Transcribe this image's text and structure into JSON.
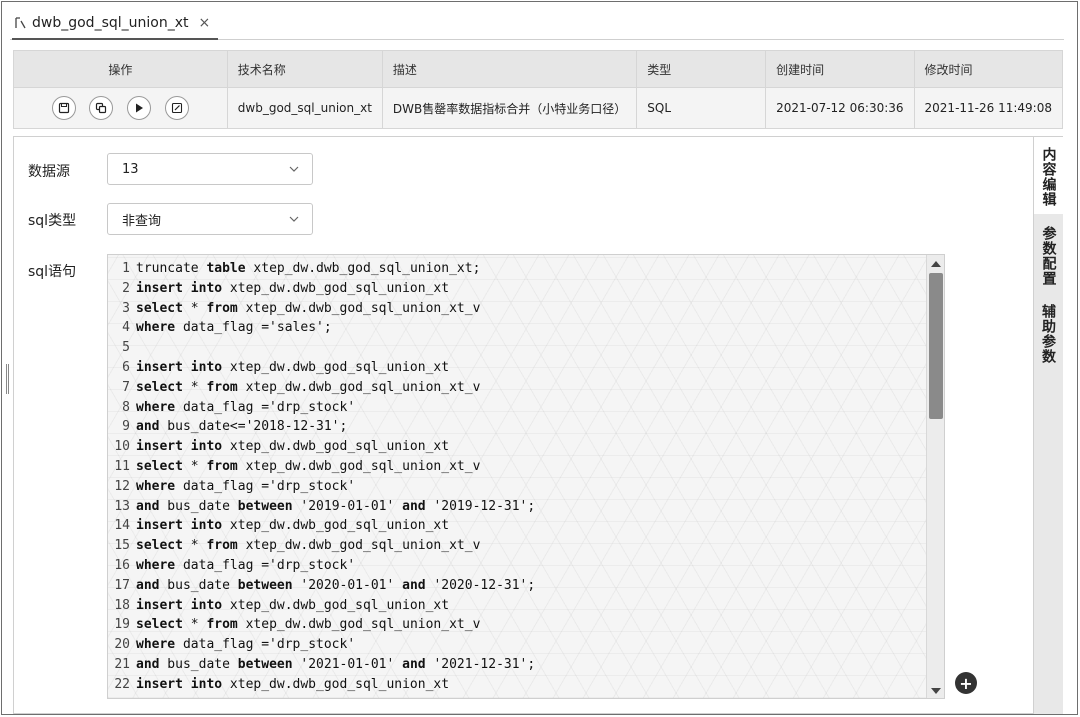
{
  "tab": {
    "label": "dwb_god_sql_union_xt",
    "close": "×"
  },
  "table": {
    "headers": [
      "操作",
      "技术名称",
      "描述",
      "类型",
      "创建时间",
      "修改时间"
    ],
    "row": {
      "tech_name": "dwb_god_sql_union_xt",
      "description": "DWB售罄率数据指标合并（小特业务口径）",
      "type": "SQL",
      "created": "2021-07-12 06:30:36",
      "modified": "2021-11-26 11:49:08"
    },
    "actions": [
      "save-icon",
      "copy-icon",
      "run-icon",
      "edit-icon"
    ]
  },
  "form": {
    "datasource_label": "数据源",
    "datasource_value": "13",
    "sqltype_label": "sql类型",
    "sqltype_value": "非查询",
    "sql_label": "sql语句"
  },
  "code_lines": [
    [
      [
        "kw0",
        "truncate "
      ],
      [
        "kw1",
        "table"
      ],
      [
        "kw0",
        " xtep_dw.dwb_god_sql_union_xt;"
      ]
    ],
    [
      [
        "kw1",
        "insert into"
      ],
      [
        "kw0",
        " xtep_dw.dwb_god_sql_union_xt"
      ]
    ],
    [
      [
        "kw1",
        "select"
      ],
      [
        "kw0",
        " * "
      ],
      [
        "kw1",
        "from"
      ],
      [
        "kw0",
        " xtep_dw.dwb_god_sql_union_xt_v"
      ]
    ],
    [
      [
        "kw1",
        "where"
      ],
      [
        "kw0",
        " data_flag ='sales';"
      ]
    ],
    [],
    [
      [
        "kw1",
        "insert into"
      ],
      [
        "kw0",
        " xtep_dw.dwb_god_sql_union_xt"
      ]
    ],
    [
      [
        "kw1",
        "select"
      ],
      [
        "kw0",
        " * "
      ],
      [
        "kw1",
        "from"
      ],
      [
        "kw0",
        " xtep_dw.dwb_god_sql_union_xt_v"
      ]
    ],
    [
      [
        "kw1",
        "where"
      ],
      [
        "kw0",
        " data_flag ='drp_stock'"
      ]
    ],
    [
      [
        "kw1",
        "and"
      ],
      [
        "kw0",
        " bus_date<='2018-12-31';"
      ]
    ],
    [
      [
        "kw1",
        "insert into"
      ],
      [
        "kw0",
        " xtep_dw.dwb_god_sql_union_xt"
      ]
    ],
    [
      [
        "kw1",
        "select"
      ],
      [
        "kw0",
        " * "
      ],
      [
        "kw1",
        "from"
      ],
      [
        "kw0",
        " xtep_dw.dwb_god_sql_union_xt_v"
      ]
    ],
    [
      [
        "kw1",
        "where"
      ],
      [
        "kw0",
        " data_flag ='drp_stock'"
      ]
    ],
    [
      [
        "kw1",
        "and"
      ],
      [
        "kw0",
        " bus_date "
      ],
      [
        "kw1",
        "between"
      ],
      [
        "kw0",
        " '2019-01-01' "
      ],
      [
        "kw1",
        "and"
      ],
      [
        "kw0",
        " '2019-12-31';"
      ]
    ],
    [
      [
        "kw1",
        "insert into"
      ],
      [
        "kw0",
        " xtep_dw.dwb_god_sql_union_xt"
      ]
    ],
    [
      [
        "kw1",
        "select"
      ],
      [
        "kw0",
        " * "
      ],
      [
        "kw1",
        "from"
      ],
      [
        "kw0",
        " xtep_dw.dwb_god_sql_union_xt_v"
      ]
    ],
    [
      [
        "kw1",
        "where"
      ],
      [
        "kw0",
        " data_flag ='drp_stock'"
      ]
    ],
    [
      [
        "kw1",
        "and"
      ],
      [
        "kw0",
        " bus_date "
      ],
      [
        "kw1",
        "between"
      ],
      [
        "kw0",
        " '2020-01-01' "
      ],
      [
        "kw1",
        "and"
      ],
      [
        "kw0",
        " '2020-12-31';"
      ]
    ],
    [
      [
        "kw1",
        "insert into"
      ],
      [
        "kw0",
        " xtep_dw.dwb_god_sql_union_xt"
      ]
    ],
    [
      [
        "kw1",
        "select"
      ],
      [
        "kw0",
        " * "
      ],
      [
        "kw1",
        "from"
      ],
      [
        "kw0",
        " xtep_dw.dwb_god_sql_union_xt_v"
      ]
    ],
    [
      [
        "kw1",
        "where"
      ],
      [
        "kw0",
        " data_flag ='drp_stock'"
      ]
    ],
    [
      [
        "kw1",
        "and"
      ],
      [
        "kw0",
        " bus_date "
      ],
      [
        "kw1",
        "between"
      ],
      [
        "kw0",
        " '2021-01-01' "
      ],
      [
        "kw1",
        "and"
      ],
      [
        "kw0",
        " '2021-12-31';"
      ]
    ],
    [
      [
        "kw1",
        "insert into"
      ],
      [
        "kw0",
        " xtep_dw.dwb_god_sql_union_xt"
      ]
    ]
  ],
  "side_tabs": [
    "内容编辑",
    "参数配置",
    "辅助参数"
  ]
}
